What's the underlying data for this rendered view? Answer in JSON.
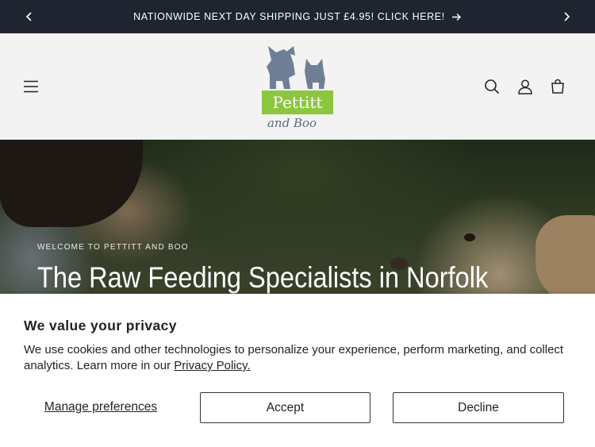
{
  "announcement": {
    "message": "NATIONWIDE NEXT DAY SHIPPING JUST £4.95! CLICK HERE!",
    "prev_icon": "chevron-left-icon",
    "next_icon": "chevron-right-icon",
    "arrow_icon": "arrow-right-icon",
    "background": "#1e2430"
  },
  "header": {
    "menu_icon": "hamburger-menu-icon",
    "search_icon": "search-icon",
    "account_icon": "account-icon",
    "cart_icon": "cart-icon",
    "logo": {
      "brand_name": "Pettitt",
      "sub_name": "and Boo",
      "brand_green": "#8cc63f",
      "mascot_color": "#6f7f96"
    }
  },
  "hero": {
    "eyebrow": "WELCOME TO PETTITT AND BOO",
    "headline": "The Raw Feeding Specialists in Norfolk"
  },
  "cookie_banner": {
    "title": "We value your privacy",
    "description": "We use cookies and other technologies to personalize your experience, perform marketing, and collect analytics. Learn more in our ",
    "policy_link": "Privacy Policy.",
    "manage_label": "Manage preferences",
    "accept_label": "Accept",
    "decline_label": "Decline"
  }
}
